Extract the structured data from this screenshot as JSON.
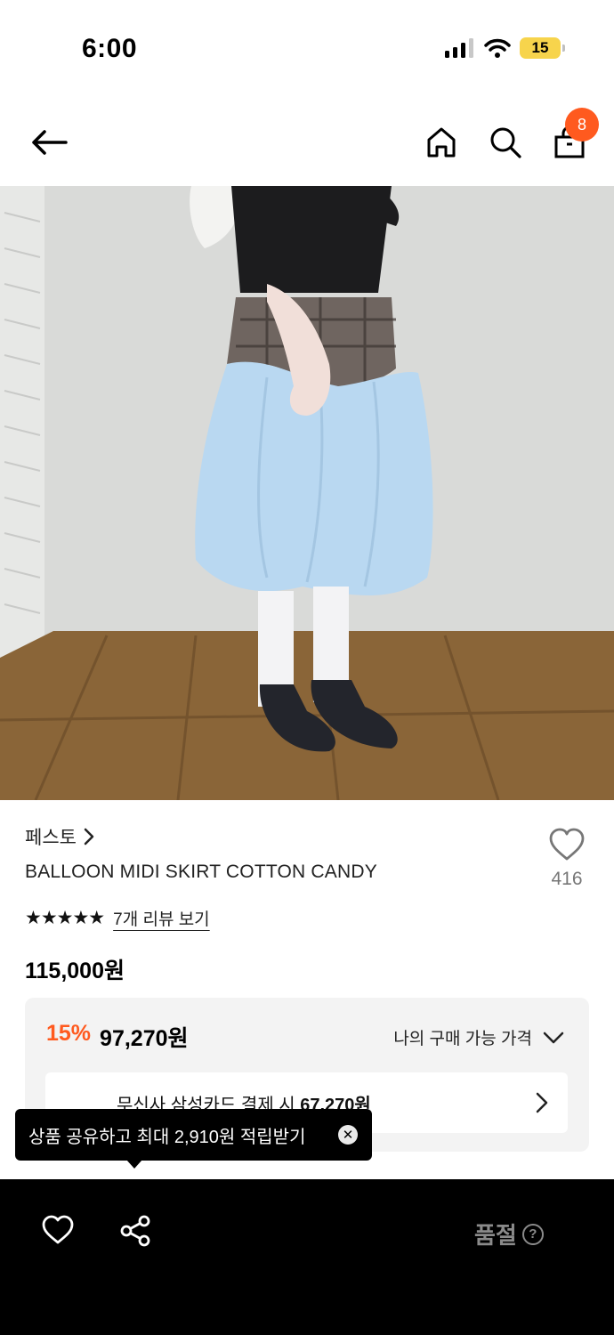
{
  "status_bar": {
    "time": "6:00",
    "battery": "15"
  },
  "nav": {
    "cart_count": "8"
  },
  "product": {
    "brand": "페스토",
    "name": "BALLOON MIDI SKIRT COTTON CANDY",
    "like_count": "416",
    "stars": "★★★★★",
    "review_link": "7개 리뷰 보기",
    "original_price": "115,000원"
  },
  "price_panel": {
    "discount_rate": "15%",
    "discount_price": "97,270원",
    "my_price_label": "나의 구매 가능 가격",
    "card_prefix": "무신사 삼성카드 결제 시 ",
    "card_price": "67,270원"
  },
  "tooltip": {
    "text": "상품 공유하고 최대 2,910원 적립받기",
    "close": "✕"
  },
  "bottom_bar": {
    "soldout_label": "품절",
    "help": "?"
  },
  "colors": {
    "accent": "#ff5a1f",
    "panel_bg": "#f3f3f3",
    "bottom_bar": "#000000",
    "battery": "#f7d44c"
  }
}
